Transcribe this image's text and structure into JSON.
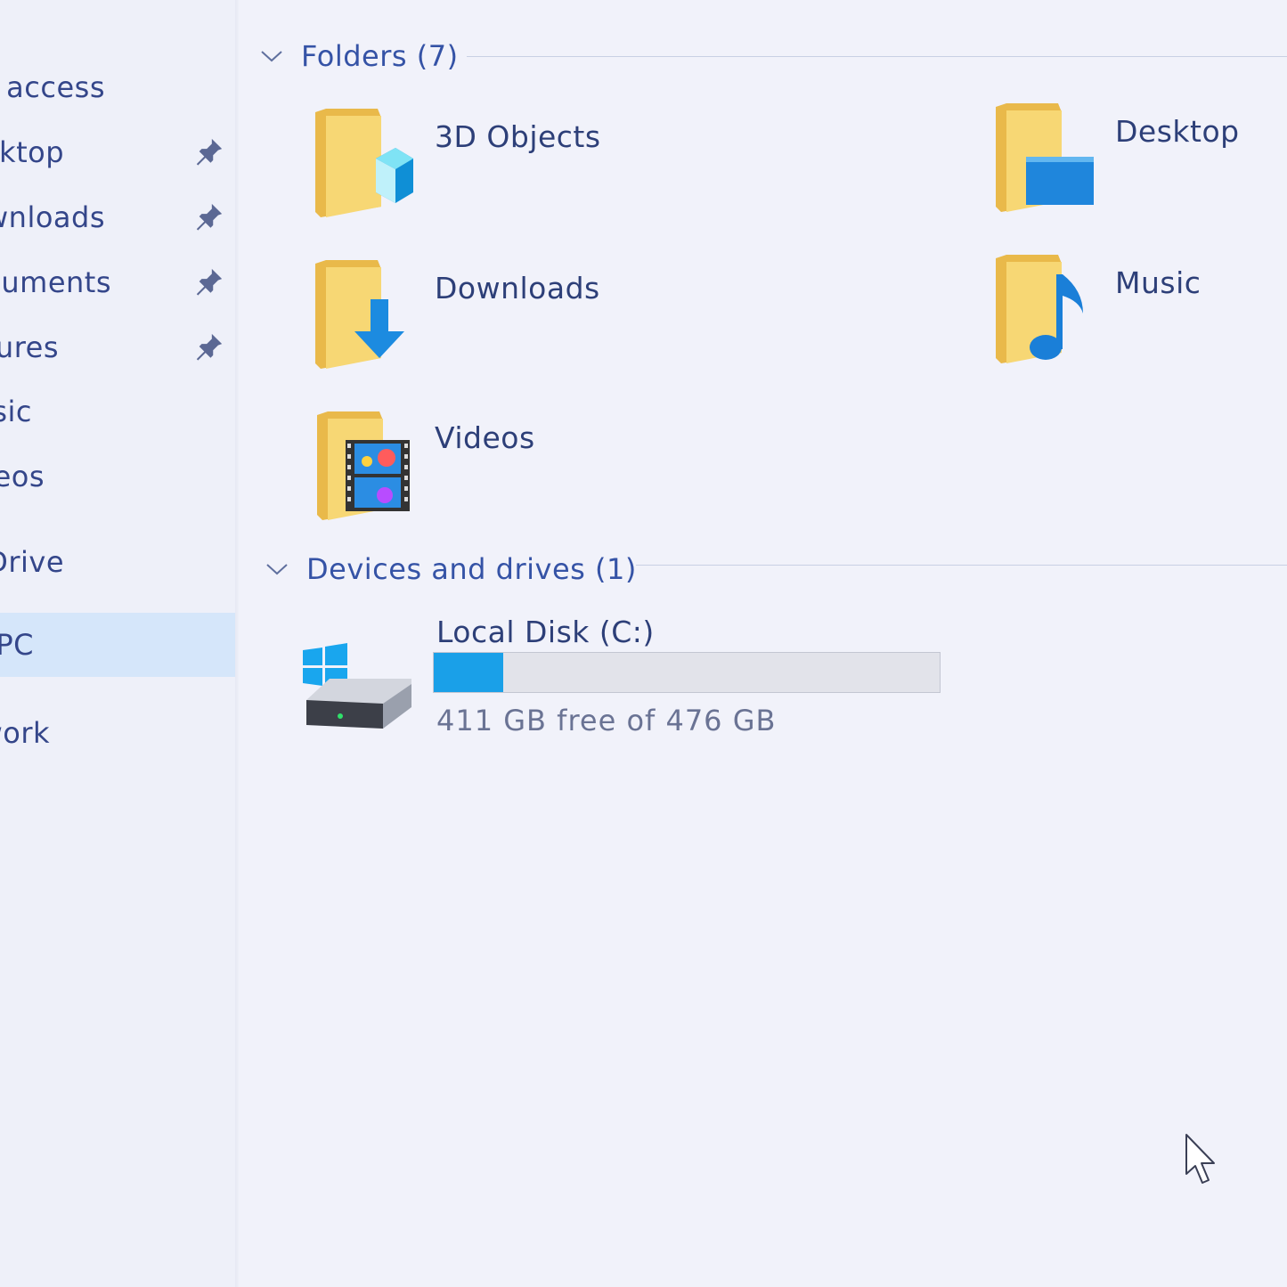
{
  "sidebar": {
    "items": [
      {
        "label": "k access",
        "pinned": false
      },
      {
        "label": "ktop",
        "pinned": true
      },
      {
        "label": "wnloads",
        "pinned": true
      },
      {
        "label": "cuments",
        "pinned": true
      },
      {
        "label": "ures",
        "pinned": true
      },
      {
        "label": "sic",
        "pinned": false
      },
      {
        "label": "eos",
        "pinned": false
      },
      {
        "label": "Drive",
        "pinned": false
      },
      {
        "label": "PC",
        "pinned": false,
        "selected": true
      },
      {
        "label": "work",
        "pinned": false
      }
    ]
  },
  "folders_group": {
    "title": "Folders (7)",
    "items": [
      {
        "name": "3D Objects",
        "icon": "3d-objects-folder-icon"
      },
      {
        "name": "Desktop",
        "icon": "desktop-folder-icon"
      },
      {
        "name": "Downloads",
        "icon": "downloads-folder-icon"
      },
      {
        "name": "Music",
        "icon": "music-folder-icon"
      },
      {
        "name": "Videos",
        "icon": "videos-folder-icon"
      }
    ]
  },
  "devices_group": {
    "title": "Devices and drives (1)",
    "drives": [
      {
        "name": "Local Disk (C:)",
        "free_text": "411 GB free of 476 GB",
        "used_fraction": 0.137,
        "icon": "windows-drive-icon"
      }
    ]
  },
  "colors": {
    "accent": "#1aa0e8",
    "folder": "#f5cf66",
    "selection": "#d5e6fa"
  }
}
